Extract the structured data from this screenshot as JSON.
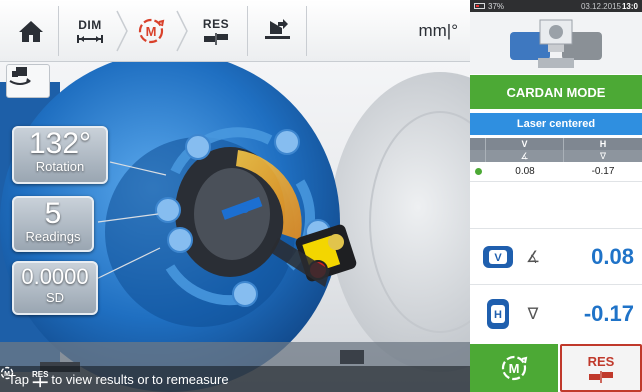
{
  "toolbar": {
    "home_icon": "home-icon",
    "dim_label": "DIM",
    "measure_icon": "measure-m-icon",
    "res_label": "RES",
    "units": "mm|°"
  },
  "scene": {
    "rotation_value": "132°",
    "rotation_label": "Rotation",
    "readings_value": "5",
    "readings_label": "Readings",
    "sd_value": "0.0000",
    "sd_label": "SD",
    "hint_before": "Tap",
    "hint_res": "RES",
    "hint_middle": "to view results or",
    "hint_after": "to remeasure"
  },
  "status": {
    "battery": "37%",
    "date": "03.12.2015",
    "time": "13:0"
  },
  "panel": {
    "mode_label": "CARDAN MODE",
    "laser_status": "Laser centered",
    "table_headers": [
      "V",
      "H"
    ],
    "table_row": {
      "v": "0.08",
      "h": "-0.17"
    },
    "vertical_value": "0.08",
    "horizontal_value": "-0.17",
    "v_badge": "V",
    "h_badge": "H",
    "res_button": "RES"
  },
  "colors": {
    "accent_green": "#4ca935",
    "accent_blue": "#2f8fe0",
    "value_blue": "#1f73c8",
    "alert_red": "#c0392b"
  }
}
